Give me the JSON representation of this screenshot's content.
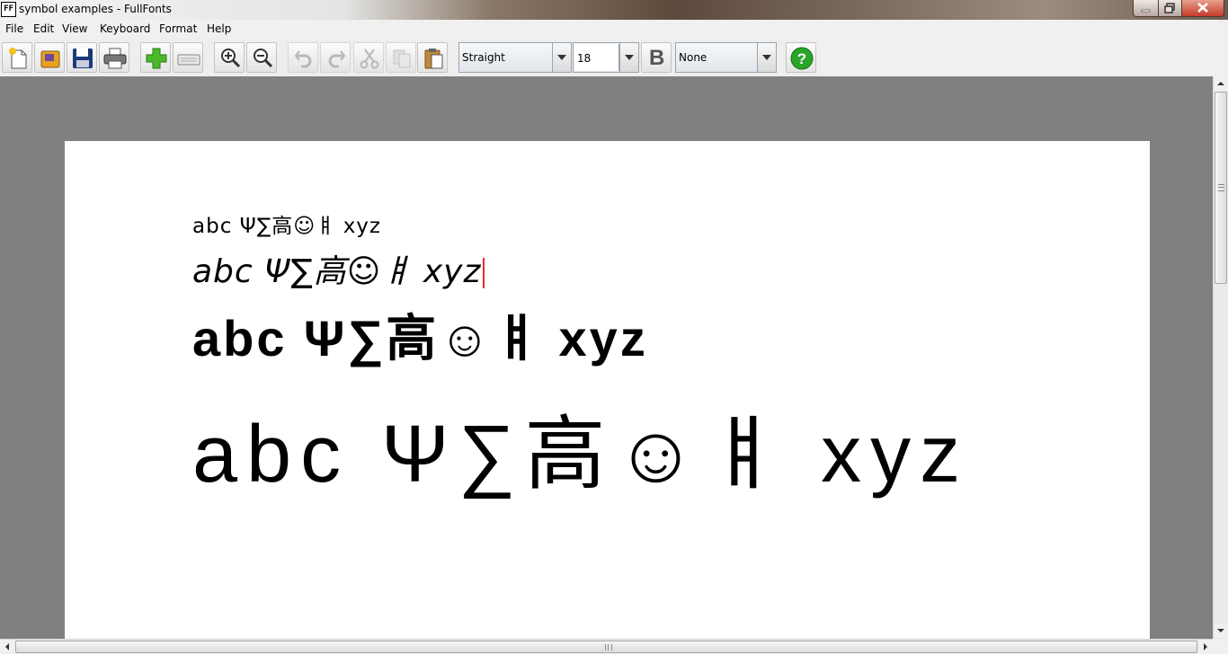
{
  "window": {
    "app_icon": "FF",
    "title": "symbol examples - FullFonts"
  },
  "menubar": {
    "items": [
      "File",
      "Edit",
      "View",
      "Keyboard",
      "Format",
      "Help"
    ]
  },
  "toolbar": {
    "buttons": [
      "new-document-icon",
      "open-folder-icon",
      "save-icon",
      "print-icon",
      "add-symbol-icon",
      "keyboard-icon",
      "zoom-in-icon",
      "zoom-out-icon",
      "undo-icon",
      "redo-icon",
      "cut-icon",
      "copy-icon",
      "paste-icon",
      "bold-icon",
      "help-icon"
    ],
    "style_value": "Straight",
    "size_value": "18",
    "bold_label": "B",
    "effect_value": "None",
    "help_color": "#2aa52a"
  },
  "document": {
    "lines": [
      "abc Ψ∑高☺ㅒ xyz",
      "abc Ψ∑高☺ㅒ xyz",
      "abc Ψ∑高☺ㅒ xyz",
      "abc Ψ∑高☺ㅒ xyz"
    ],
    "caret_color": "#e03030"
  }
}
